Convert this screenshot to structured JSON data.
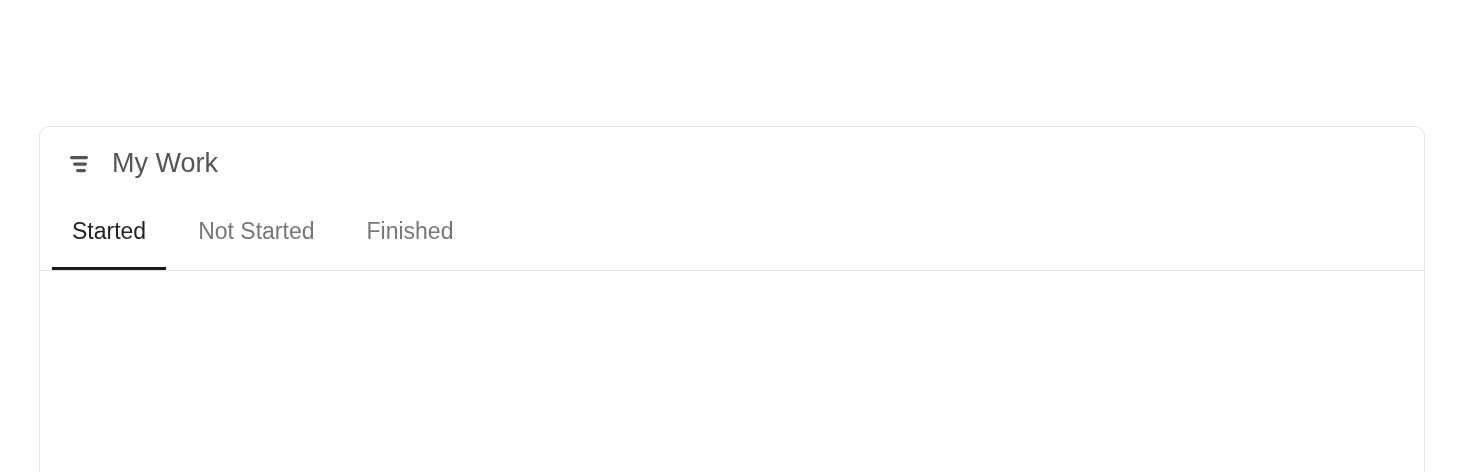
{
  "card": {
    "title": "My Work",
    "tabs": [
      {
        "label": "Started",
        "selected": true
      },
      {
        "label": "Not Started",
        "selected": false
      },
      {
        "label": "Finished",
        "selected": false
      }
    ]
  }
}
